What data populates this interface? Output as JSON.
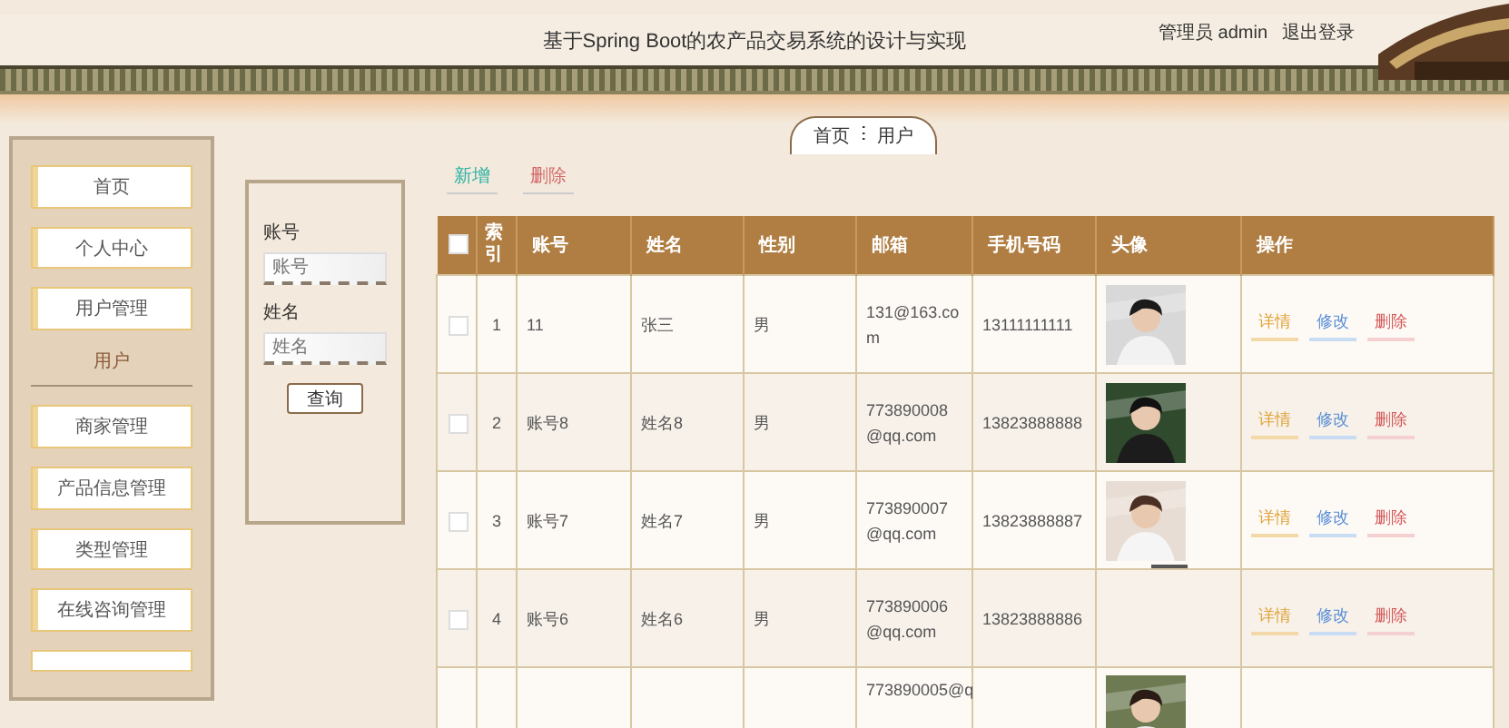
{
  "header": {
    "title": "基于Spring Boot的农产品交易系统的设计与实现",
    "user": "管理员 admin",
    "logout": "退出登录"
  },
  "breadcrumb": {
    "home": "首页",
    "separator": "ⵗ",
    "current": "用户"
  },
  "sidebar": {
    "items": [
      {
        "label": "首页"
      },
      {
        "label": "个人中心"
      },
      {
        "label": "用户管理"
      }
    ],
    "section": "用户",
    "items2": [
      {
        "label": "商家管理"
      },
      {
        "label": "产品信息管理"
      },
      {
        "label": "类型管理"
      },
      {
        "label": "在线咨询管理"
      }
    ]
  },
  "search": {
    "fields": [
      {
        "label": "账号",
        "placeholder": "账号"
      },
      {
        "label": "姓名",
        "placeholder": "姓名"
      }
    ],
    "button": "查询"
  },
  "actions": {
    "add": "新增",
    "delete": "删除"
  },
  "table": {
    "columns": [
      "索引",
      "账号",
      "姓名",
      "性别",
      "邮箱",
      "手机号码",
      "头像",
      "操作"
    ],
    "header_checked": false,
    "rows": [
      {
        "kind": "full",
        "checked": false,
        "index": "1",
        "account": "11",
        "name": "张三",
        "gender": "男",
        "email": "131@163.com",
        "phone": "13111111111",
        "avatar": {
          "kind": "picture"
        },
        "actions": [
          "详情",
          "修改",
          "删除"
        ]
      },
      {
        "kind": "full",
        "checked": false,
        "index": "2",
        "account": "账号8",
        "name": "姓名8",
        "gender": "男",
        "email": "773890008@qq.com",
        "phone": "13823888888",
        "avatar": {
          "kind": "picture"
        },
        "actions": [
          "详情",
          "修改",
          "删除"
        ]
      },
      {
        "kind": "full",
        "checked": false,
        "index": "3",
        "account": "账号7",
        "name": "姓名7",
        "gender": "男",
        "email": "773890007@qq.com",
        "phone": "13823888887",
        "avatar": {
          "kind": "picture"
        },
        "actions": [
          "详情",
          "修改",
          "删除"
        ]
      },
      {
        "kind": "full",
        "checked": false,
        "index": "4",
        "account": "账号6",
        "name": "姓名6",
        "gender": "男",
        "email": "773890006@qq.com",
        "phone": "13823888886",
        "avatar": {
          "kind": "broken"
        },
        "actions": [
          "详情",
          "修改",
          "删除"
        ]
      },
      {
        "kind": "partial",
        "email": "773890005@q",
        "avatar": {
          "kind": "picture"
        }
      }
    ]
  }
}
